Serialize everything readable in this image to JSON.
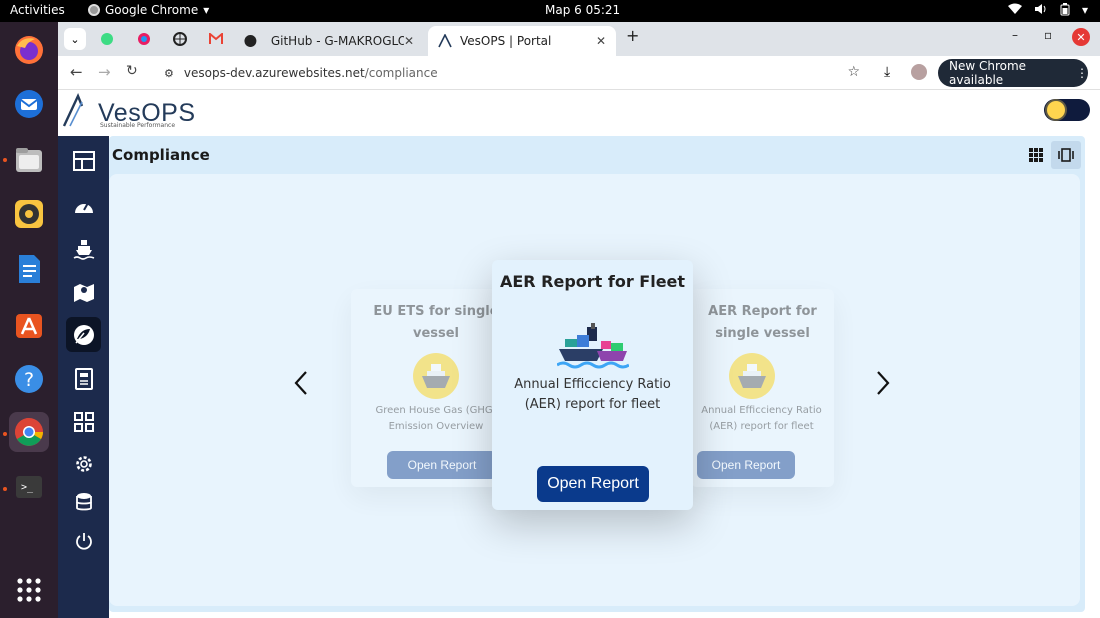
{
  "os": {
    "activities": "Activities",
    "app_menu": "Google Chrome",
    "clock": "Мар 6  05:21"
  },
  "browser": {
    "tabs": [
      {
        "label": "GitHub - G-MAKROGLOU"
      },
      {
        "label": "VesOPS | Portal"
      }
    ],
    "url_domain": "vesops-dev.azurewebsites.net",
    "url_path": "/compliance",
    "update_label": "New Chrome available"
  },
  "app": {
    "logo": "VesOPS",
    "logo_tagline": "Sustainable Performance",
    "page_title": "Compliance"
  },
  "carousel": {
    "prev_icon": "chevron-left-icon",
    "next_icon": "chevron-right-icon",
    "cards": [
      {
        "title_line1": "EU ETS for single",
        "title_line2": "vessel",
        "desc_line1": "Green House Gas (GHG)",
        "desc_line2": "Emission Overview",
        "button": "Open Report"
      },
      {
        "title": "AER Report for Fleet",
        "desc_line1": "Annual Efficciency Ratio",
        "desc_line2": "(AER) report for fleet",
        "button": "Open Report"
      },
      {
        "title_line1": "AER Report for",
        "title_line2": "single vessel",
        "desc_line1": "Annual Efficciency Ratio",
        "desc_line2": "(AER) report for fleet",
        "button": "Open Report"
      }
    ]
  },
  "colors": {
    "sidebar": "#1c2a4c",
    "button": "#0a3a8c",
    "content_bg": "#e8f4fd"
  }
}
